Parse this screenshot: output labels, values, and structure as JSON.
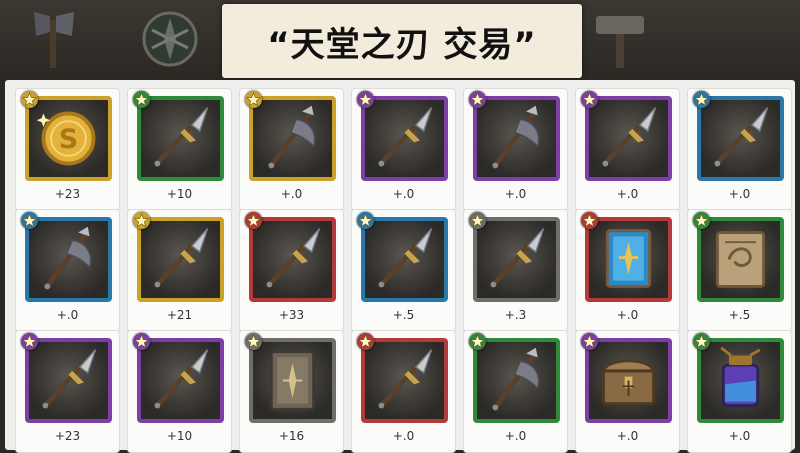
{
  "title": "“天堂之刃 交易”",
  "top_icons": [
    "axe-icon",
    "emblem-icon",
    "hammer-icon"
  ],
  "rarity_colors": {
    "gold": "#c9a227",
    "green": "#2f8a3a",
    "purple": "#7b3fa6",
    "blue": "#2a78a8",
    "red": "#b23a3a",
    "gray": "#6e6e6a"
  },
  "items": [
    {
      "icon": "gold-coin-icon",
      "rarity": "gold",
      "count": "+23"
    },
    {
      "icon": "spear-icon",
      "rarity": "green",
      "count": "+10"
    },
    {
      "icon": "axe-icon",
      "rarity": "gold",
      "count": "+.0"
    },
    {
      "icon": "spear-icon",
      "rarity": "purple",
      "count": "+.0"
    },
    {
      "icon": "axe-icon",
      "rarity": "purple",
      "count": "+.0"
    },
    {
      "icon": "spear-icon",
      "rarity": "purple",
      "count": "+.0"
    },
    {
      "icon": "spear-icon",
      "rarity": "blue",
      "count": "+.0"
    },
    {
      "icon": "axe-icon",
      "rarity": "blue",
      "count": "+.0"
    },
    {
      "icon": "spear-icon",
      "rarity": "gold",
      "count": "+21"
    },
    {
      "icon": "spear-icon",
      "rarity": "red",
      "count": "+33"
    },
    {
      "icon": "spear-icon",
      "rarity": "blue",
      "count": "+.5"
    },
    {
      "icon": "spear-icon",
      "rarity": "gray",
      "count": "+.3"
    },
    {
      "icon": "blue-card-icon",
      "rarity": "red",
      "count": "+.0"
    },
    {
      "icon": "scroll-icon",
      "rarity": "green",
      "count": "+.5"
    },
    {
      "icon": "spear-icon",
      "rarity": "purple",
      "count": "+23"
    },
    {
      "icon": "spear-icon",
      "rarity": "purple",
      "count": "+10"
    },
    {
      "icon": "rune-tablet-icon",
      "rarity": "gray",
      "count": "+16"
    },
    {
      "icon": "spear-icon",
      "rarity": "red",
      "count": "+.0"
    },
    {
      "icon": "axe-icon",
      "rarity": "green",
      "count": "+.0"
    },
    {
      "icon": "chest-icon",
      "rarity": "purple",
      "count": "+.0"
    },
    {
      "icon": "potion-jar-icon",
      "rarity": "green",
      "count": "+.0"
    }
  ]
}
